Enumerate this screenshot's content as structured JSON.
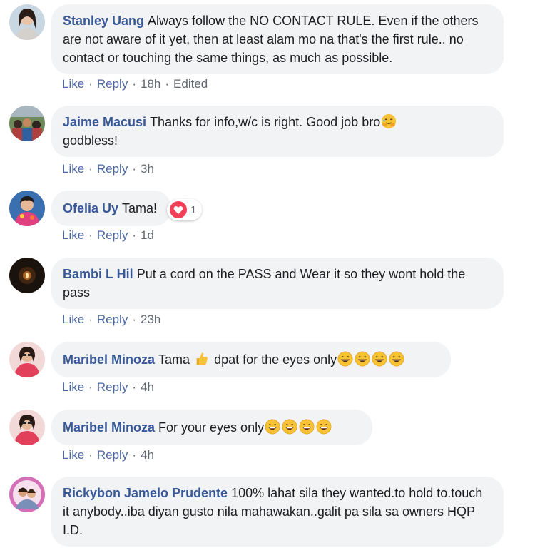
{
  "comments": [
    {
      "author": "Stanley Uang",
      "text": "Always follow the NO CONTACT RULE. Even if the others are not aware of it yet, then at least alam mo na that's the first rule.. no contact or touching the same things, as much as possible.",
      "like": "Like",
      "reply": "Reply",
      "time": "18h",
      "edited": "Edited"
    },
    {
      "author": "Jaime Macusi",
      "text": "Thanks for info,w/c is right. Good job bro",
      "text2": "godbless!",
      "like": "Like",
      "reply": "Reply",
      "time": "3h"
    },
    {
      "author": "Ofelia Uy",
      "text": "Tama!",
      "reaction_count": "1",
      "like": "Like",
      "reply": "Reply",
      "time": "1d"
    },
    {
      "author": "Bambi L Hil",
      "text": "Put a cord on the PASS and Wear it so they wont hold the pass",
      "like": "Like",
      "reply": "Reply",
      "time": "23h"
    },
    {
      "author": "Maribel Minoza",
      "text": "Tama",
      "text2": "dpat for the eyes only",
      "like": "Like",
      "reply": "Reply",
      "time": "4h"
    },
    {
      "author": "Maribel Minoza",
      "text": "For your eyes only",
      "like": "Like",
      "reply": "Reply",
      "time": "4h"
    },
    {
      "author": "Rickybon Jamelo Prudente",
      "text": "100% lahat sila they wanted.to hold to.touch it anybody..iba diyan gusto nila mahawakan..galit pa sila sa owners HQP I.D."
    }
  ],
  "separator": "·",
  "colors": {
    "link": "#385898",
    "bubble": "#f2f3f5",
    "meta": "#606770"
  },
  "icons": [
    "avatar-photo",
    "grin-emoji",
    "thumbs-up-emoji",
    "tearful-hug-emoji",
    "heart-reaction-icon"
  ]
}
